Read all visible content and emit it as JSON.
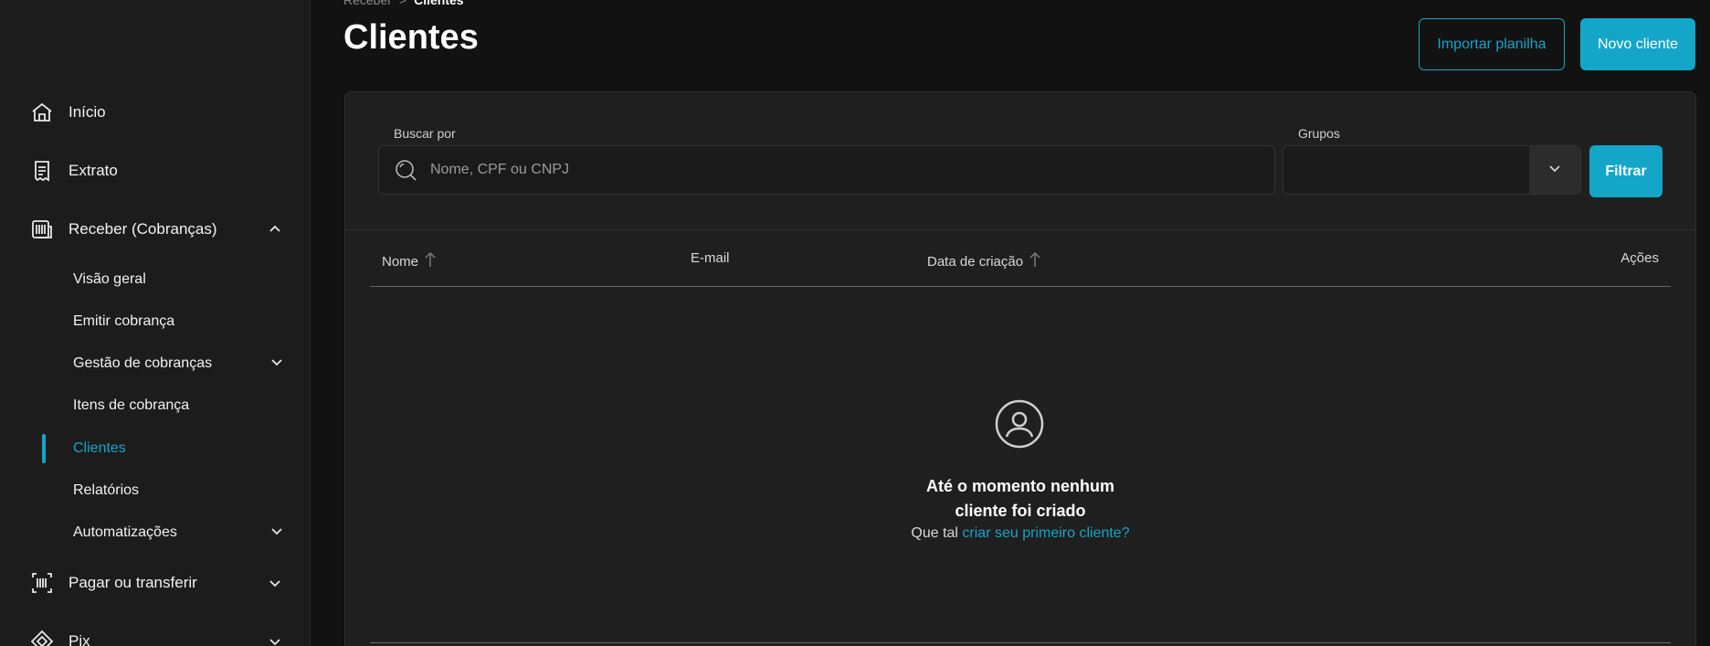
{
  "sidebar": {
    "items": [
      {
        "label": "Início",
        "icon": "home-icon"
      },
      {
        "label": "Extrato",
        "icon": "receipt-icon"
      },
      {
        "label": "Receber (Cobranças)",
        "icon": "barcode-doc-icon"
      },
      {
        "label": "Pagar ou transferir",
        "icon": "barcode-scan-icon"
      },
      {
        "label": "Pix",
        "icon": "pix-icon"
      }
    ],
    "subitems": [
      {
        "label": "Visão geral"
      },
      {
        "label": "Emitir cobrança"
      },
      {
        "label": "Gestão de cobranças"
      },
      {
        "label": "Itens de cobrança"
      },
      {
        "label": "Clientes"
      },
      {
        "label": "Relatórios"
      },
      {
        "label": "Automatizações"
      }
    ]
  },
  "breadcrumb": {
    "parent": "Receber",
    "separator": ">",
    "current": "Clientes"
  },
  "page": {
    "title": "Clientes"
  },
  "actions": {
    "import_label": "Importar planilha",
    "new_label": "Novo cliente"
  },
  "filters": {
    "search_label": "Buscar por",
    "search_placeholder": "Nome, CPF ou CNPJ",
    "groups_label": "Grupos",
    "filter_button": "Filtrar"
  },
  "table": {
    "columns": [
      "Nome",
      "E-mail",
      "Data de criação",
      "Ações"
    ]
  },
  "empty_state": {
    "title_line1": "Até o momento nenhum",
    "title_line2": "cliente foi criado",
    "prefix": "Que tal",
    "link": "criar seu primeiro cliente?"
  },
  "colors": {
    "accent": "#13a6c9",
    "background": "#121212",
    "sidebar": "#1c1c1c",
    "card": "#1f1f1f"
  }
}
